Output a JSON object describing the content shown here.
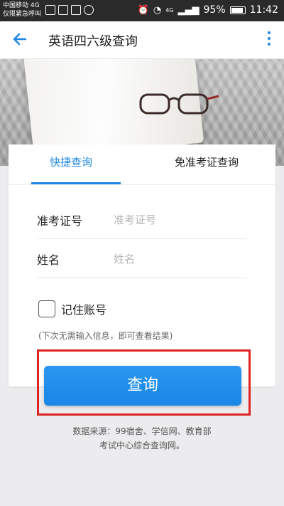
{
  "status_bar": {
    "carrier_line1": "中国移动 4G",
    "carrier_line2": "仅限紧急呼叫",
    "net_label": "4G",
    "battery": "95%",
    "time": "11:42"
  },
  "app_bar": {
    "title": "英语四六级查询"
  },
  "tabs": [
    {
      "label": "快捷查询",
      "active": true
    },
    {
      "label": "免准考证查询",
      "active": false
    }
  ],
  "form": {
    "ticket_label": "准考证号",
    "ticket_placeholder": "准考证号",
    "ticket_value": "",
    "name_label": "姓名",
    "name_placeholder": "姓名",
    "name_value": "",
    "remember_label": "记住账号",
    "remember_checked": false,
    "hint": "(下次无需输入信息，即可查看结果)"
  },
  "query_button": "查询",
  "source_line1": "数据来源：99宿舍、学信网、教育部",
  "source_line2": "考试中心综合查询网。",
  "colors": {
    "accent": "#1f87e5",
    "highlight": "#e02222"
  }
}
